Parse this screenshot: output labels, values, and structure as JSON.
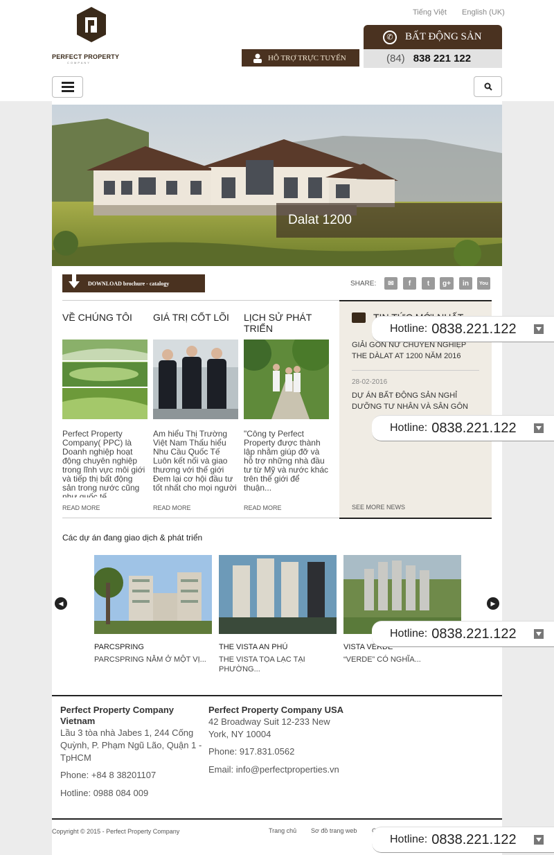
{
  "header": {
    "brand": "PERFECT PROPERTY",
    "brand_sub": "COMPANY",
    "lang_vi": "Tiếng Việt",
    "lang_en": "English (UK)",
    "support_label": "HỖ TRỢ TRỰC TUYẾN",
    "hotline_title": "BẤT ĐỘNG SẢN",
    "hotline_prefix": "(84)",
    "hotline_number": "838 221 122"
  },
  "banner": {
    "caption": "Dalat 1200"
  },
  "toolbar": {
    "download_label": "DOWNLOAD brochure - catalogy",
    "share_label": "SHARE:"
  },
  "columns": [
    {
      "title": "VỀ CHÚNG TÔI",
      "text": "Perfect Property Company( PPC) là Doanh nghiệp hoạt động chuyên nghiệp trong lĩnh vực môi giới và tiếp thị bất động sản trong nước cũng như quốc tế",
      "readmore": "READ MORE"
    },
    {
      "title": "GIÁ TRỊ CỐT LÕI",
      "text": "Am hiểu Thị Trường Việt Nam Thấu hiểu Nhu Cầu Quốc Tế Luôn kết nối và giao thương với thế giới Đem lại cơ hội đầu tư tốt nhất cho mọi người",
      "readmore": "READ MORE"
    },
    {
      "title": "LỊCH SỬ PHÁT TRIỂN",
      "text": "\"Công ty Perfect Property được thành lập nhằm giúp đỡ và hỗ trợ những nhà đầu tư từ Mỹ và nước khác trên thế giới để thuận...",
      "readmore": "READ MORE"
    }
  ],
  "news": {
    "title": "TIN TỨC MỚI NHẤT",
    "item1": "GIẢI GÔN NỮ CHUYÊN NGHIỆP THE DÀLAT AT 1200 NĂM 2016",
    "date2": "28-02-2016",
    "item2": "DỰ ÁN BẤT ĐỘNG SẢN NGHỈ DƯỠNG TƯ NHÂN VÀ SÂN GÔN",
    "see_more": "SEE MORE NEWS"
  },
  "projects": {
    "heading": "Các dự án đang giao dịch & phát triển",
    "items": [
      {
        "name": "PARCSPRING",
        "desc": "PARCSPRING NẰM Ở MỘT VỊ..."
      },
      {
        "name": "THE VISTA AN PHÚ",
        "desc": "THE VISTA TỌA LẠC TẠI PHƯỜNG..."
      },
      {
        "name": "VISTA VERDE",
        "desc": "“VERDE” CÓ NGHĨA..."
      }
    ]
  },
  "footer": {
    "vn_head": "Perfect Property Company Vietnam",
    "vn_address": "Lầu 3 tòa nhà Jabes 1, 244 Cống Quỳnh, P. Phạm Ngũ Lão, Quận 1 - TpHCM",
    "vn_phone": "Phone: +84 8 38201107",
    "vn_hotline": "Hotline: 0988 084 009",
    "us_head": "Perfect Property Company USA",
    "us_address": "42 Broadway Suit 12-233 New York, NY 10004",
    "us_phone": "Phone: 917.831.0562",
    "us_email": "Email: info@perfectproperties.vn",
    "copyright": "Copyright © 2015 - Perfect Property Company",
    "link_home": "Trang chủ",
    "link_sitemap": "Sơ đồ trang web",
    "link_partial": "Ch"
  },
  "floating_hotline": {
    "label": "Hotline:",
    "number": "0838.221.122"
  },
  "colors": {
    "brand": "#4a3220",
    "news_bg": "#f0ece4"
  }
}
